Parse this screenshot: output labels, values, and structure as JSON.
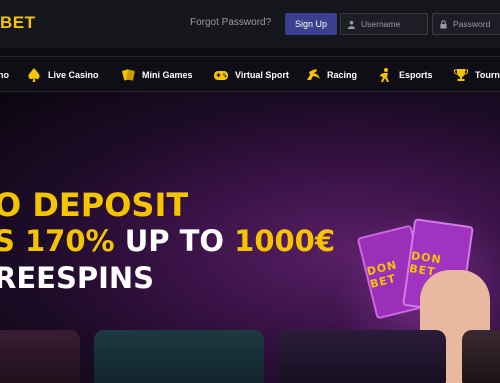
{
  "header": {
    "logo": "BET",
    "forgot_password": "Forgot Password?",
    "signup_label": "Sign Up",
    "username_placeholder": "Username",
    "password_placeholder": "Password"
  },
  "nav": {
    "items": [
      {
        "label": "no",
        "icon": "casino-icon"
      },
      {
        "label": "Live Casino",
        "icon": "spade-icon"
      },
      {
        "label": "Mini Games",
        "icon": "cards-icon"
      },
      {
        "label": "Virtual Sport",
        "icon": "gamepad-icon"
      },
      {
        "label": "Racing",
        "icon": "horse-icon"
      },
      {
        "label": "Esports",
        "icon": "esports-icon"
      },
      {
        "label": "Tourn",
        "icon": "trophy-icon"
      }
    ]
  },
  "hero": {
    "line1": "O DEPOSIT",
    "line2_yellow_a": "S 170%",
    "line2_white": "UP TO",
    "line2_yellow_b": "1000€",
    "line3": "REESPINS",
    "card_text": "DON BET"
  },
  "colors": {
    "accent": "#f5c400",
    "signup": "#3b3f8f",
    "topbar": "#16161d",
    "nav": "#0e0e14"
  }
}
